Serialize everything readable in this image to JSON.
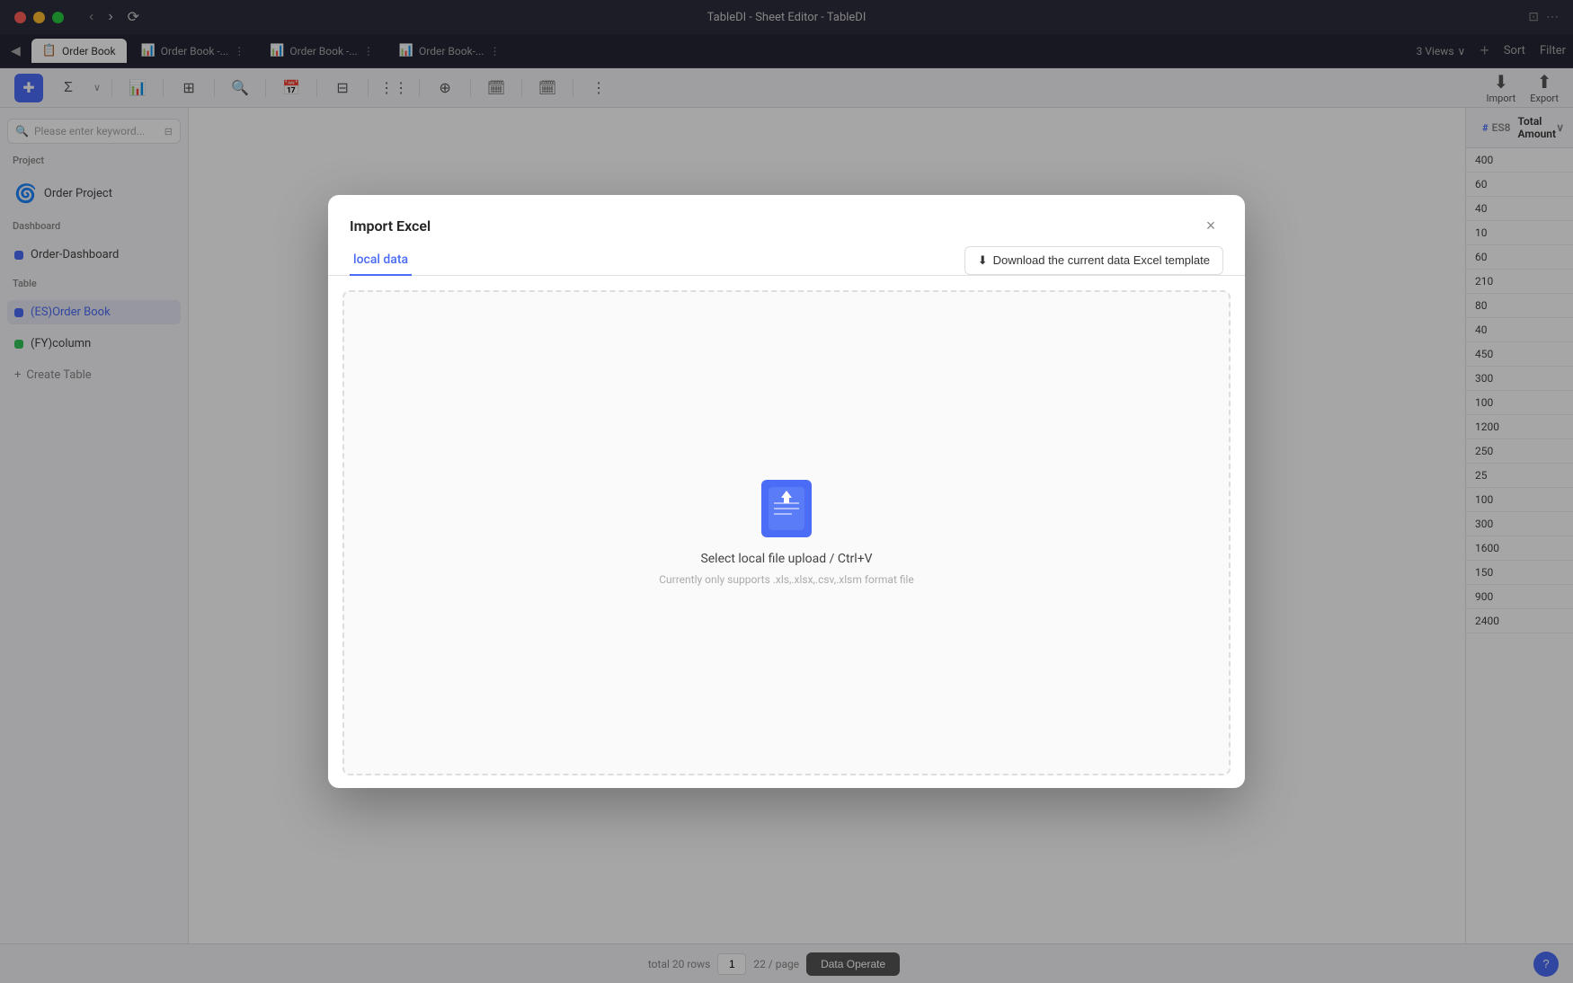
{
  "window": {
    "title": "TableDI - Sheet Editor - TableDI"
  },
  "titlebar": {
    "back_btn": "‹",
    "forward_btn": "›",
    "refresh_btn": "⟳"
  },
  "tabs": {
    "items": [
      {
        "label": "Order Book",
        "icon": "📋",
        "active": true
      },
      {
        "label": "Order Book -...",
        "icon": "📊",
        "active": false
      },
      {
        "label": "Order Book -...",
        "icon": "📊",
        "active": false
      },
      {
        "label": "Order Book-...",
        "icon": "📊",
        "active": false
      }
    ],
    "views_label": "3 Views",
    "add_tab": "+",
    "sort_label": "Sort",
    "filter_label": "Filter"
  },
  "sidebar": {
    "search_placeholder": "Please enter keyword...",
    "project_label": "Project",
    "project_item": "Order Project",
    "dashboard_label": "Dashboard",
    "dashboard_item": "Order-Dashboard",
    "table_label": "Table",
    "table_items": [
      {
        "label": "(ES)Order Book"
      },
      {
        "label": "(FY)column"
      }
    ],
    "create_table": "Create Table"
  },
  "right_panel": {
    "header": "Total Amount",
    "es8_label": "ES8",
    "values": [
      "400",
      "60",
      "40",
      "10",
      "60",
      "210",
      "80",
      "40",
      "450",
      "300",
      "100",
      "1200",
      "250",
      "25",
      "100",
      "300",
      "1600",
      "150",
      "900",
      "2400"
    ]
  },
  "bottom_bar": {
    "total_rows": "total 20 rows",
    "current_page": "1",
    "per_page": "22 / page",
    "data_operate": "Data Operate",
    "help_icon": "?"
  },
  "modal": {
    "title": "Import Excel",
    "close_icon": "×",
    "tab_local": "local data",
    "download_btn_label": "Download the current data Excel template",
    "download_icon": "⬇",
    "upload_main_text": "Select local file upload / Ctrl+V",
    "upload_sub_text": "Currently only supports .xls,.xlsx,.csv,.xlsm format file"
  }
}
